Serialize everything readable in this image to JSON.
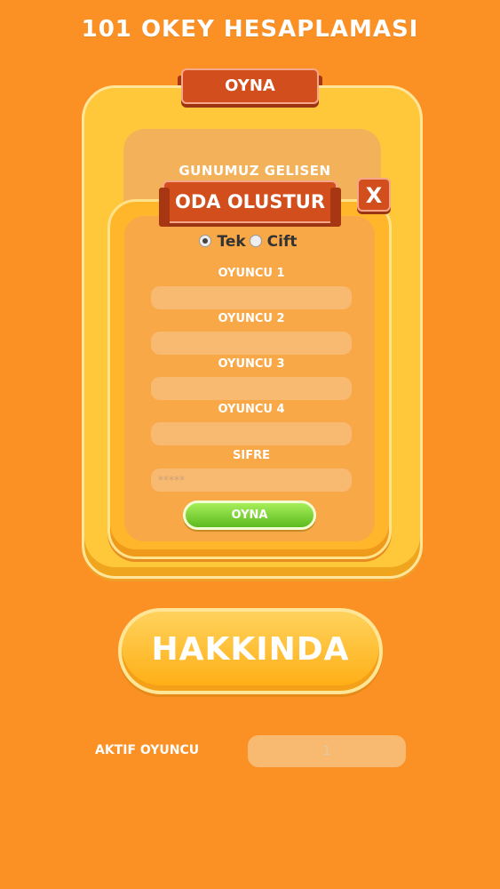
{
  "app": {
    "title": "101 OKEY HESAPLAMASI"
  },
  "main_card": {
    "ribbon_label": "OYNA",
    "text": "GUNUMUZ GELISEN"
  },
  "modal": {
    "title": "ODA OLUSTUR",
    "close_label": "X",
    "mode": {
      "options": [
        "Tek",
        "Cift"
      ],
      "selected": "Tek"
    },
    "fields": {
      "player1_label": "OYUNCU 1",
      "player1_value": "",
      "player2_label": "OYUNCU 2",
      "player2_value": "",
      "player3_label": "OYUNCU 3",
      "player3_value": "",
      "player4_label": "OYUNCU 4",
      "player4_value": "",
      "password_label": "SIFRE",
      "password_placeholder": "*****"
    },
    "play_label": "OYNA"
  },
  "about_button": "HAKKINDA",
  "active_players": {
    "label": "AKTIF OYUNCU",
    "value": "1"
  },
  "colors": {
    "background": "#fb9125",
    "card": "#ffc83a",
    "ribbon": "#d24e1c",
    "play_button": "#6ec92a"
  }
}
